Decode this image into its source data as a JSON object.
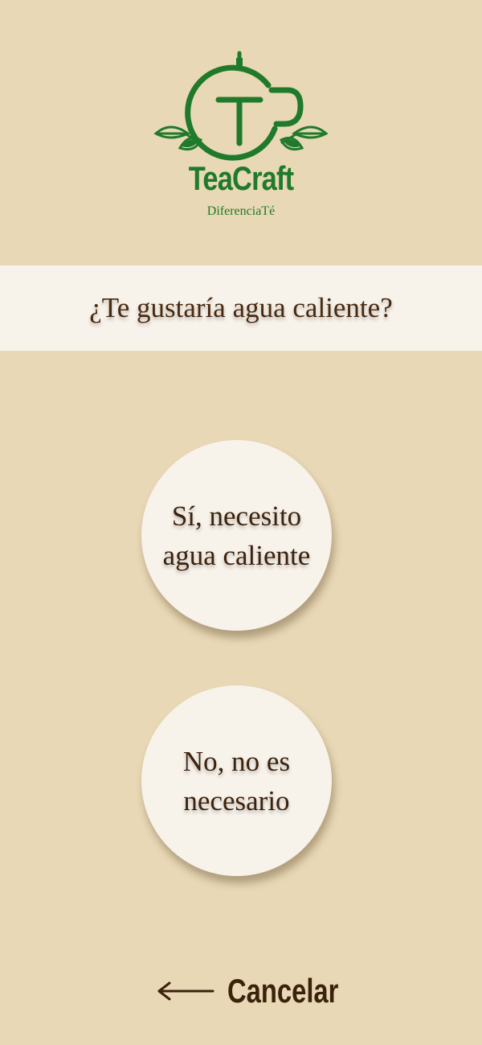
{
  "brand": {
    "name": "TeaCraft",
    "tagline": "DiferenciaTé",
    "color": "#1f7a2c"
  },
  "question": {
    "text": "¿Te gustaría agua caliente?"
  },
  "options": {
    "yes_label": "Sí, necesito agua caliente",
    "no_label": "No, no es necesario"
  },
  "footer": {
    "cancel_label": "Cancelar",
    "cancel_icon": "arrow-left-icon"
  },
  "colors": {
    "background": "#e9d8b5",
    "panel": "#f7f2ea",
    "text": "#3d220b"
  }
}
